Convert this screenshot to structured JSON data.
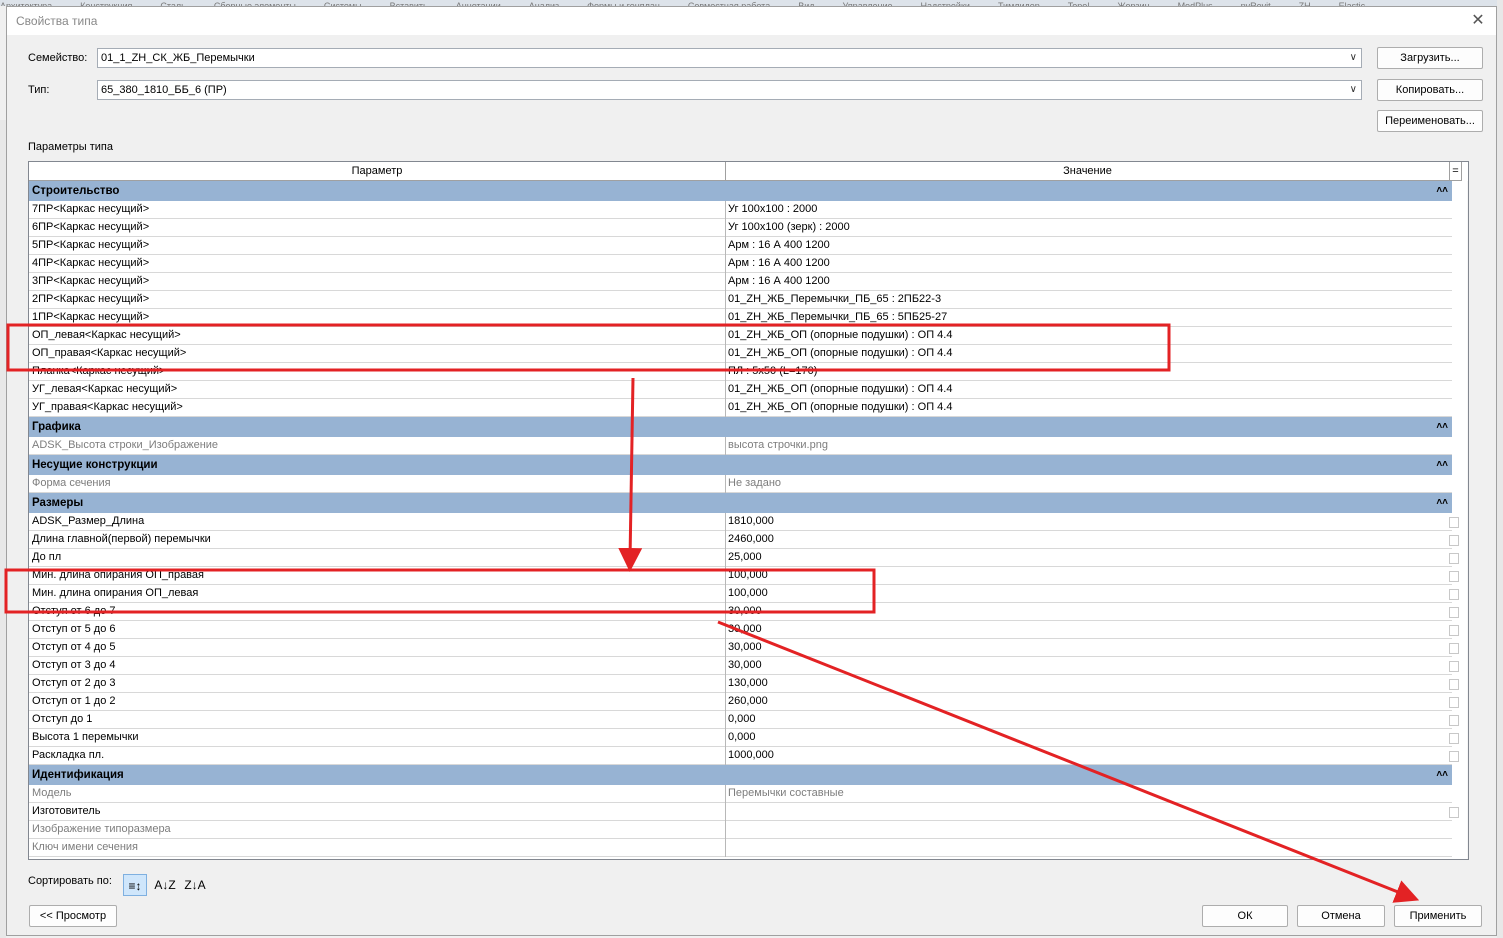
{
  "dialog": {
    "title": "Свойства типа",
    "close_glyph": "✕"
  },
  "family": {
    "label": "Семейство:",
    "value": "01_1_ZH_СК_ЖБ_Перемычки"
  },
  "type": {
    "label": "Тип:",
    "value": "65_380_1810_ББ_6 (ПР)"
  },
  "buttons": {
    "load": "Загрузить...",
    "copy": "Копировать...",
    "rename": "Переименовать...",
    "preview": "<< Просмотр",
    "ok": "ОК",
    "cancel": "Отмена",
    "apply": "Применить"
  },
  "type_params_label": "Параметры типа",
  "table": {
    "header_param": "Параметр",
    "header_value": "Значение",
    "header_extra": "=",
    "groups": [
      {
        "name": "Строительство",
        "rows": [
          {
            "p": "7ПР<Каркас несущий>",
            "v": "Уг 100x100 : 2000"
          },
          {
            "p": "6ПР<Каркас несущий>",
            "v": "Уг 100x100 (зерк) : 2000"
          },
          {
            "p": "5ПР<Каркас несущий>",
            "v": "Арм : 16 А 400 1200"
          },
          {
            "p": "4ПР<Каркас несущий>",
            "v": "Арм : 16 А 400 1200"
          },
          {
            "p": "3ПР<Каркас несущий>",
            "v": "Арм : 16 А 400 1200"
          },
          {
            "p": "2ПР<Каркас несущий>",
            "v": "01_ZH_ЖБ_Перемычки_ПБ_65 : 2ПБ22-3"
          },
          {
            "p": "1ПР<Каркас несущий>",
            "v": "01_ZH_ЖБ_Перемычки_ПБ_65 : 5ПБ25-27"
          },
          {
            "p": "ОП_левая<Каркас несущий>",
            "v": "01_ZH_ЖБ_ОП (опорные подушки) : ОП 4.4"
          },
          {
            "p": "ОП_правая<Каркас несущий>",
            "v": "01_ZH_ЖБ_ОП (опорные подушки) : ОП 4.4"
          },
          {
            "p": "Планка<Каркас несущий>",
            "v": "ПЛ : 5x50 (L=170)"
          },
          {
            "p": "УГ_левая<Каркас несущий>",
            "v": "01_ZH_ЖБ_ОП (опорные подушки) : ОП 4.4"
          },
          {
            "p": "УГ_правая<Каркас несущий>",
            "v": "01_ZH_ЖБ_ОП (опорные подушки) : ОП 4.4"
          }
        ]
      },
      {
        "name": "Графика",
        "rows": [
          {
            "p": "ADSK_Высота строки_Изображение",
            "v": "высота строчки.png",
            "gray": true
          }
        ]
      },
      {
        "name": "Несущие конструкции",
        "rows": [
          {
            "p": "Форма сечения",
            "v": "Не задано",
            "gray": true
          }
        ]
      },
      {
        "name": "Размеры",
        "rows": [
          {
            "p": "ADSK_Размер_Длина",
            "v": "1810,000",
            "cb": true
          },
          {
            "p": "Длина главной(первой) перемычки",
            "v": "2460,000",
            "cb": true
          },
          {
            "p": "До пл",
            "v": "25,000",
            "cb": true
          },
          {
            "p": "Мин. длина опирания ОП_правая",
            "v": "100,000",
            "cb": true
          },
          {
            "p": "Мин. длина опирания ОП_левая",
            "v": "100,000",
            "cb": true
          },
          {
            "p": "Отступ от 6 до 7",
            "v": "30,000",
            "cb": true
          },
          {
            "p": "Отступ от 5 до 6",
            "v": "30,000",
            "cb": true
          },
          {
            "p": "Отступ от 4 до 5",
            "v": "30,000",
            "cb": true
          },
          {
            "p": "Отступ от 3 до 4",
            "v": "30,000",
            "cb": true
          },
          {
            "p": "Отступ от 2 до 3",
            "v": "130,000",
            "cb": true
          },
          {
            "p": "Отступ от 1 до 2",
            "v": "260,000",
            "cb": true
          },
          {
            "p": "Отступ до 1",
            "v": "0,000",
            "cb": true
          },
          {
            "p": "Высота 1 перемычки",
            "v": "0,000",
            "cb": true
          },
          {
            "p": "Раскладка пл.",
            "v": "1000,000",
            "cb": true
          }
        ]
      },
      {
        "name": "Идентификация",
        "rows": [
          {
            "p": "Модель",
            "v": "Перемычки составные",
            "gray": true
          },
          {
            "p": "Изготовитель",
            "v": "",
            "cb": true
          },
          {
            "p": "Изображение типоразмера",
            "v": "",
            "gray": true
          },
          {
            "p": "Ключ имени сечения",
            "v": "",
            "gray": true
          }
        ]
      }
    ]
  },
  "sort": {
    "label": "Сортировать по:",
    "icons": [
      "≡↕",
      "A↓Z",
      "Z↓A"
    ]
  },
  "background_menu": [
    "Архитектура",
    "Конструкция",
    "Сталь",
    "Сборные элементы",
    "Системы",
    "Вставить",
    "Аннотации",
    "Анализ",
    "Формы и генплан",
    "Совместная работа",
    "Вид",
    "Управление",
    "Надстройки",
    "Тимлидер",
    "Topol",
    "Жорзин",
    "ModPlus",
    "pyRevit",
    "ZH",
    "Elastic"
  ],
  "colors": {
    "group_bg": "#97b3d3",
    "annotation_red": "#e32224"
  }
}
